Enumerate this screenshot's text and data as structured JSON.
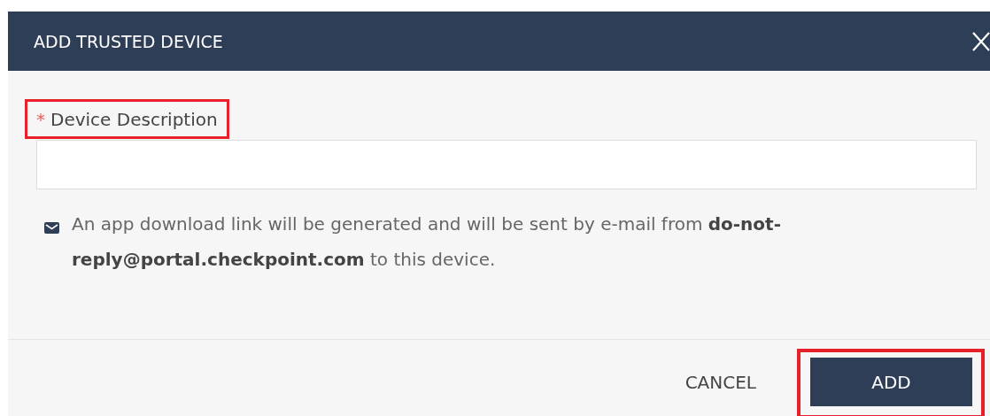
{
  "dialog": {
    "title": "ADD TRUSTED DEVICE"
  },
  "field": {
    "required_mark": "*",
    "label": "Device Description",
    "highlighted": true
  },
  "note": "An app download link will be generated and will be sent by e-mail from **do-not-reply@portal.checkpoint.com** to this device.",
  "buttons": [
    {
      "kind": "text",
      "label": "CANCEL",
      "highlighted": false
    },
    {
      "kind": "primary",
      "label": "ADD",
      "highlighted": true
    }
  ]
}
